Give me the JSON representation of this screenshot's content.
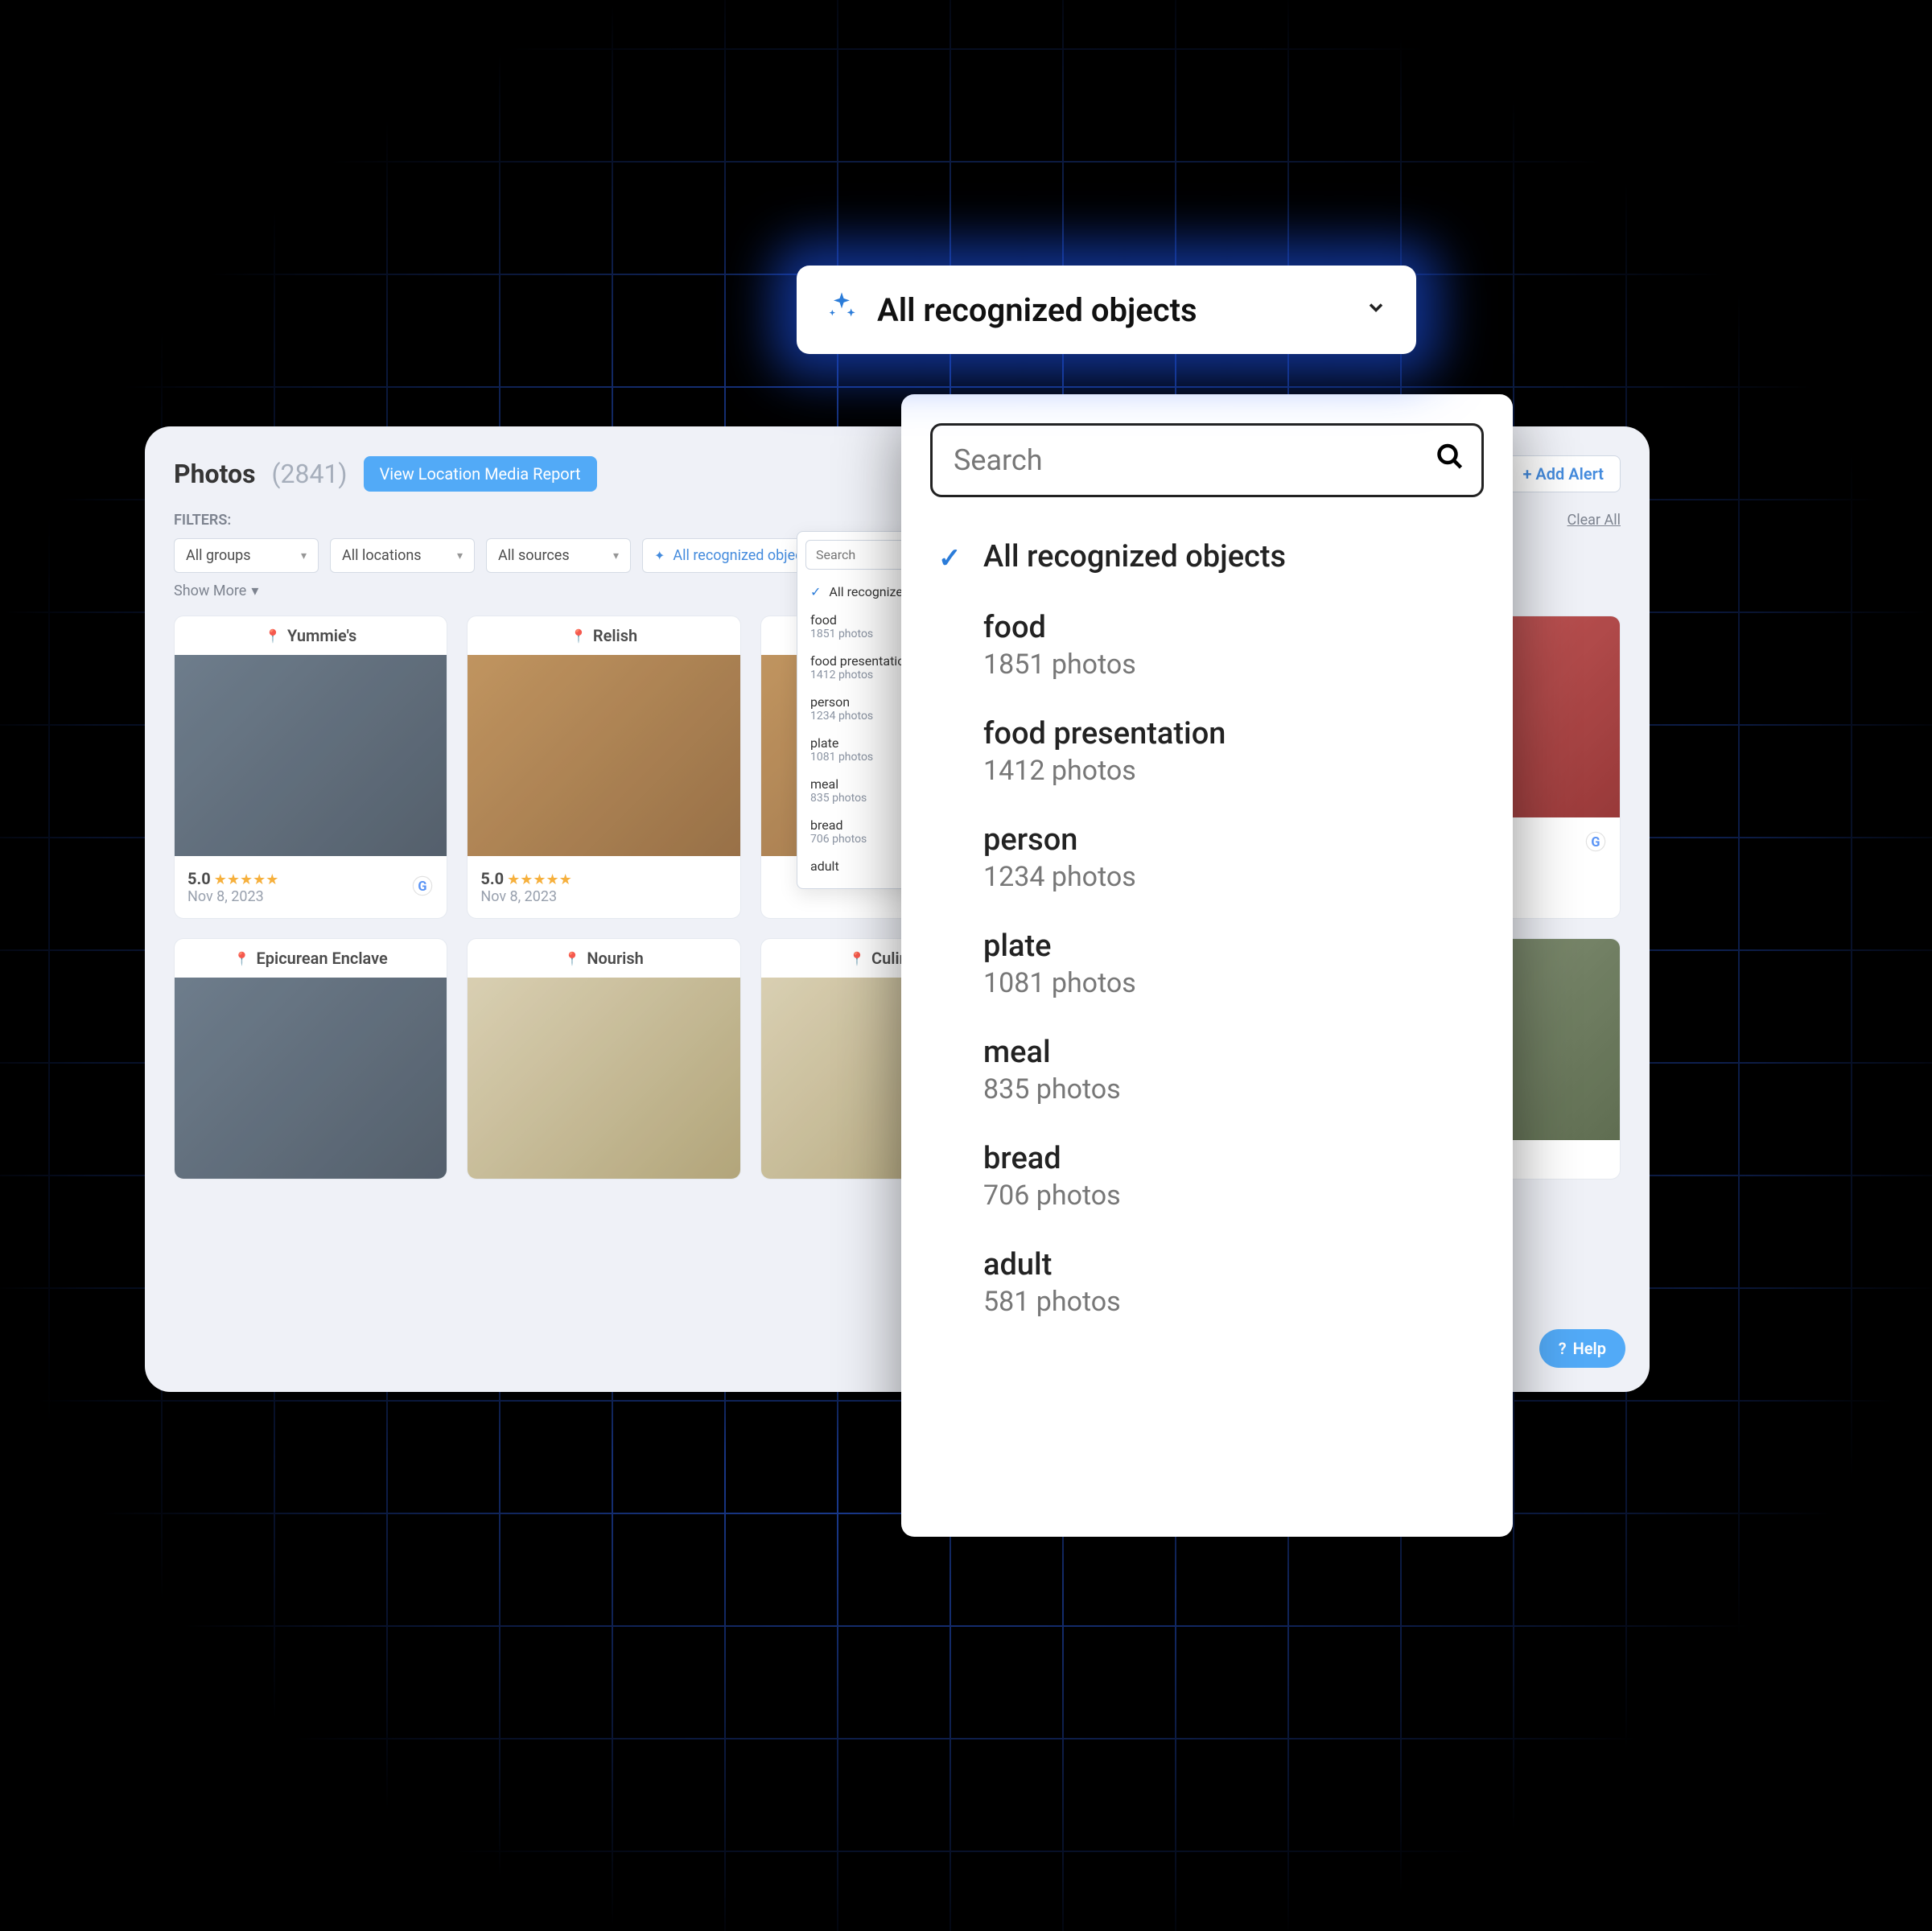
{
  "header": {
    "title": "Photos",
    "count": "(2841)",
    "media_report_label": "View Location Media Report",
    "add_alert_label": "+ Add Alert"
  },
  "filters": {
    "label": "FILTERS:",
    "clear_all": "Clear All",
    "chips": [
      "All groups",
      "All locations",
      "All sources",
      "All recognized objects"
    ],
    "show_more": "Show More"
  },
  "small_dropdown": {
    "search_placeholder": "Search",
    "all_label": "All recognized objects",
    "items": [
      {
        "name": "food",
        "count": "1851 photos"
      },
      {
        "name": "food presentation",
        "count": "1412 photos"
      },
      {
        "name": "person",
        "count": "1234 photos"
      },
      {
        "name": "plate",
        "count": "1081 photos"
      },
      {
        "name": "meal",
        "count": "835 photos"
      },
      {
        "name": "bread",
        "count": "706 photos"
      },
      {
        "name": "adult",
        "count": ""
      }
    ]
  },
  "big_trigger": {
    "label": "All recognized objects"
  },
  "big_dropdown": {
    "search_placeholder": "Search",
    "all_label": "All recognized objects",
    "items": [
      {
        "name": "food",
        "count": "1851 photos"
      },
      {
        "name": "food presentation",
        "count": "1412 photos"
      },
      {
        "name": "person",
        "count": "1234 photos"
      },
      {
        "name": "plate",
        "count": "1081 photos"
      },
      {
        "name": "meal",
        "count": "835 photos"
      },
      {
        "name": "bread",
        "count": "706 photos"
      },
      {
        "name": "adult",
        "count": "581 photos"
      }
    ]
  },
  "cards": [
    {
      "name": "Yummie's",
      "rating": "5.0",
      "date": "Nov 8, 2023"
    },
    {
      "name": "Relish",
      "rating": "5.0",
      "date": "Nov 8, 2023"
    },
    {
      "name": "",
      "rating": "",
      "date": ""
    },
    {
      "name": "",
      "rating": "",
      "date": ""
    },
    {
      "name": "",
      "rating": "",
      "date": ""
    },
    {
      "name": "Epicurean Enclave",
      "rating": "",
      "date": ""
    },
    {
      "name": "Nourish",
      "rating": "",
      "date": ""
    },
    {
      "name": "Culinary C",
      "rating": "",
      "date": ""
    },
    {
      "name": "",
      "rating": "",
      "date": ""
    },
    {
      "name": "",
      "rating": "",
      "date": ""
    }
  ],
  "help": {
    "label": "Help"
  }
}
